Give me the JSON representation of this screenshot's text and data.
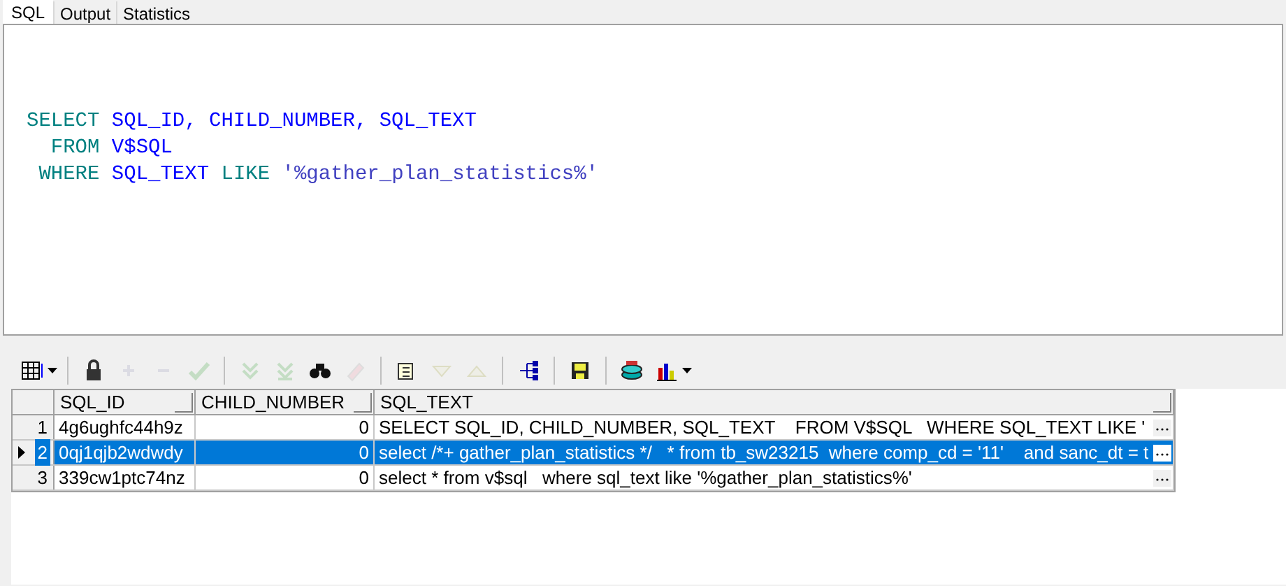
{
  "tabs": [
    {
      "label": "SQL",
      "selected": true
    },
    {
      "label": "Output",
      "selected": false
    },
    {
      "label": "Statistics",
      "selected": false
    }
  ],
  "editor": {
    "lines": [
      [
        {
          "kind": "kw",
          "text": "SELECT "
        },
        {
          "kind": "id",
          "text": "SQL_ID, CHILD_NUMBER, SQL_TEXT"
        }
      ],
      [
        {
          "kind": "kw",
          "text": "  FROM "
        },
        {
          "kind": "id",
          "text": "V$SQL"
        }
      ],
      [
        {
          "kind": "kw",
          "text": " WHERE "
        },
        {
          "kind": "id",
          "text": "SQL_TEXT "
        },
        {
          "kind": "kw",
          "text": "LIKE "
        },
        {
          "kind": "str",
          "text": "'%gather_plan_statistics%'"
        }
      ]
    ]
  },
  "toolbar": [
    {
      "kind": "grid",
      "disabled": false
    },
    {
      "kind": "sep"
    },
    {
      "kind": "lock",
      "disabled": false
    },
    {
      "kind": "plus",
      "disabled": true
    },
    {
      "kind": "minus",
      "disabled": true
    },
    {
      "kind": "check",
      "disabled": true
    },
    {
      "kind": "sep"
    },
    {
      "kind": "first",
      "disabled": true
    },
    {
      "kind": "last",
      "disabled": true
    },
    {
      "kind": "find",
      "disabled": false
    },
    {
      "kind": "clear",
      "disabled": true
    },
    {
      "kind": "sep"
    },
    {
      "kind": "export",
      "disabled": false
    },
    {
      "kind": "down",
      "disabled": true
    },
    {
      "kind": "up",
      "disabled": true
    },
    {
      "kind": "sep"
    },
    {
      "kind": "tree",
      "disabled": false
    },
    {
      "kind": "sep"
    },
    {
      "kind": "save",
      "disabled": false
    },
    {
      "kind": "sep"
    },
    {
      "kind": "db",
      "disabled": false
    },
    {
      "kind": "chart",
      "disabled": false
    }
  ],
  "table": {
    "columns": [
      "SQL_ID",
      "CHILD_NUMBER",
      "SQL_TEXT"
    ],
    "rows": [
      {
        "number": "1",
        "selected": false,
        "cells": [
          "4g6ughfc44h9z",
          "0",
          "SELECT SQL_ID, CHILD_NUMBER, SQL_TEXT    FROM V$SQL   WHERE SQL_TEXT LIKE '"
        ]
      },
      {
        "number": "2",
        "selected": true,
        "cells": [
          "0qj1qjb2wdwdy",
          "0",
          "select /*+ gather_plan_statistics */   * from tb_sw23215  where comp_cd = '11'    and sanc_dt = t"
        ]
      },
      {
        "number": "3",
        "selected": false,
        "cells": [
          "339cw1ptc74nz",
          "0",
          "select * from v$sql   where sql_text like '%gather_plan_statistics%'"
        ]
      }
    ]
  }
}
